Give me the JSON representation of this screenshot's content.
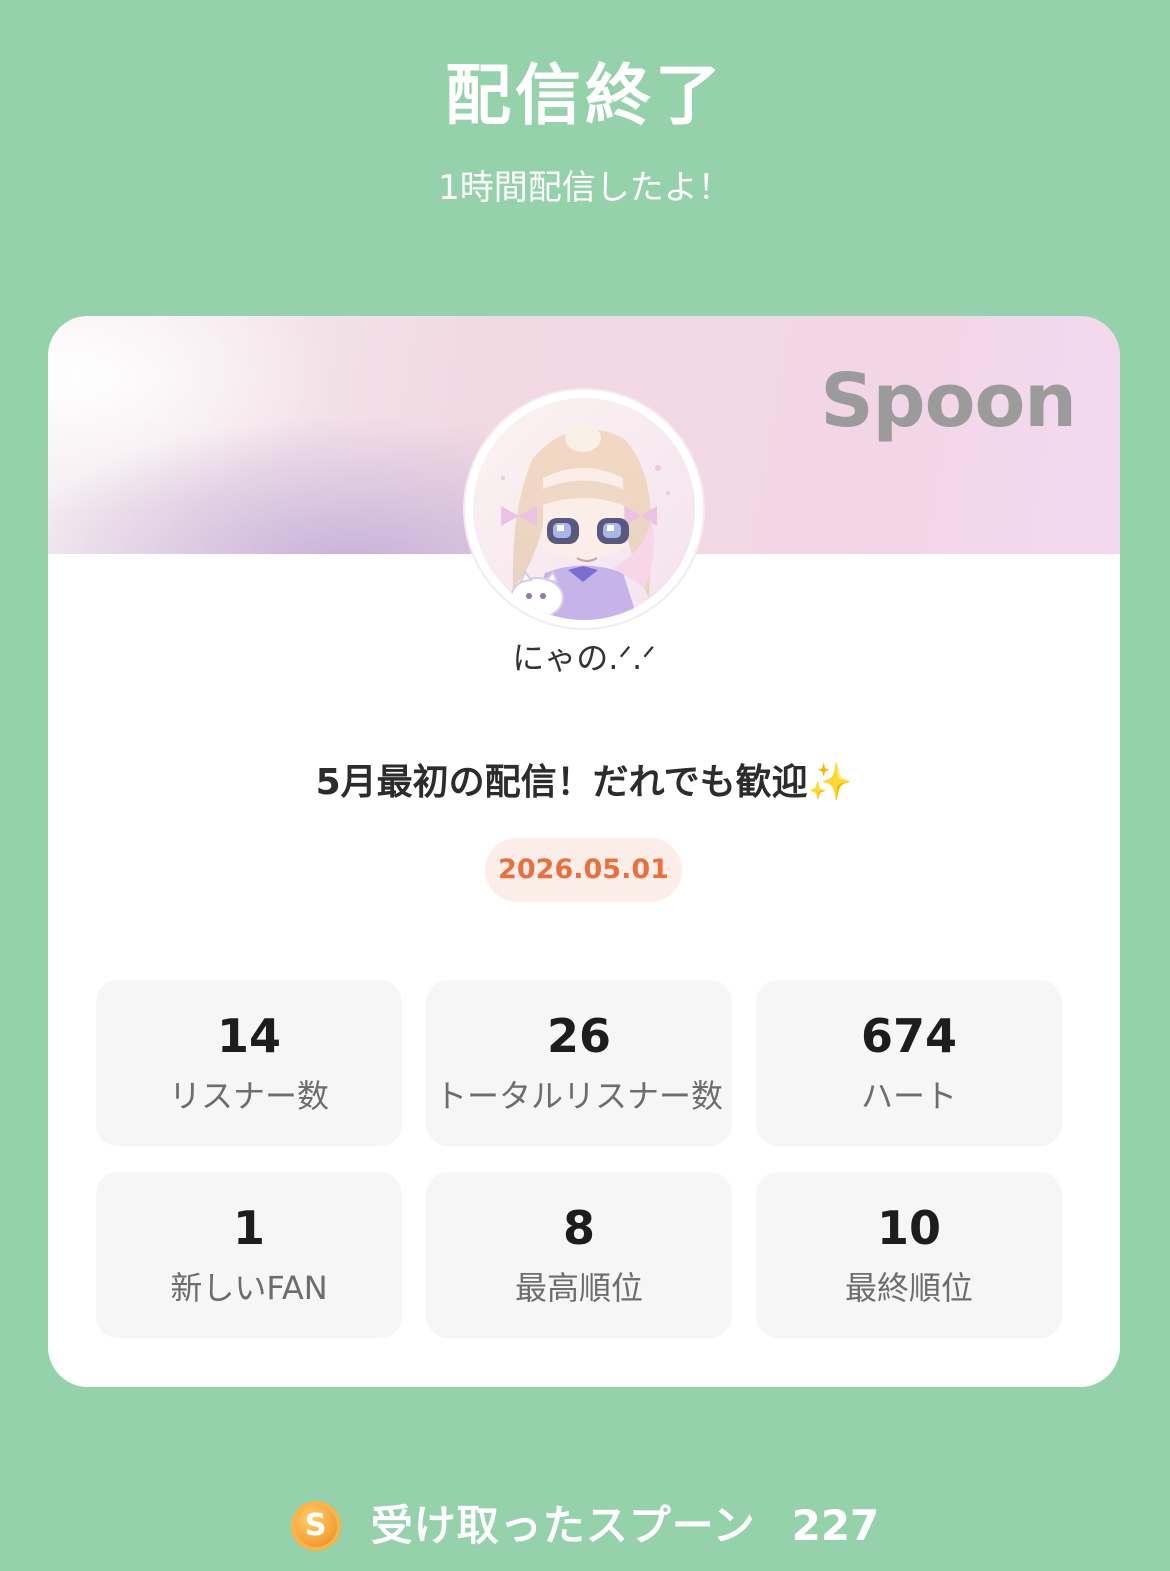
{
  "header": {
    "title": "配信終了",
    "subtitle": "1時間配信したよ！"
  },
  "card": {
    "brand": "Spoon",
    "username": "にゃの.ᐟ.ᐟ",
    "broadcast_title": "5月最初の配信！だれでも歓迎✨",
    "date": "2026.05.01",
    "stats": [
      {
        "value": "14",
        "label": "リスナー数"
      },
      {
        "value": "26",
        "label": "トータルリスナー数"
      },
      {
        "value": "674",
        "label": "ハート"
      },
      {
        "value": "1",
        "label": "新しいFAN"
      },
      {
        "value": "8",
        "label": "最高順位"
      },
      {
        "value": "10",
        "label": "最終順位"
      }
    ]
  },
  "footer": {
    "icon_letter": "S",
    "spoon_label": "受け取ったスプーン",
    "spoon_count": "227"
  },
  "colors": {
    "background": "#95d1aa",
    "card": "#ffffff",
    "tile": "#f6f6f6",
    "date_text": "#e8703f",
    "date_badge": "#fbeee8",
    "brand_logo": "#9b9b9b",
    "coin": "#f5a23a"
  },
  "icons": {
    "avatar": "anime-girl-avatar",
    "coin": "spoon-coin-icon"
  }
}
